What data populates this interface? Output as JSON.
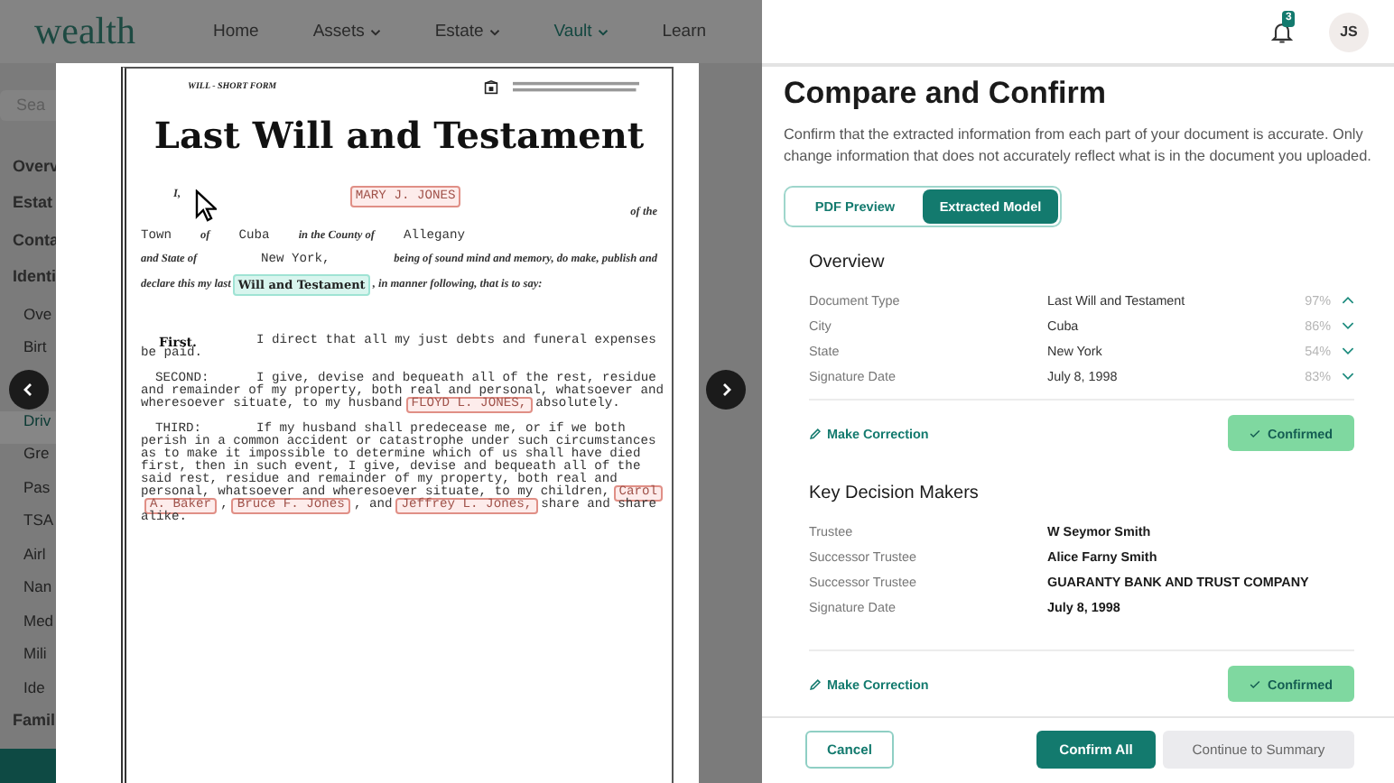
{
  "app_nav": {
    "logo": "wealth",
    "items": [
      {
        "label": "Home",
        "dropdown": false,
        "selected": false
      },
      {
        "label": "Assets",
        "dropdown": true,
        "selected": false
      },
      {
        "label": "Estate",
        "dropdown": true,
        "selected": false
      },
      {
        "label": "Vault",
        "dropdown": true,
        "selected": true
      },
      {
        "label": "Learn",
        "dropdown": false,
        "selected": false
      }
    ]
  },
  "sidebar": {
    "search": {
      "placeholder": "Sea"
    },
    "items": [
      {
        "label": "Overv",
        "kind": "section",
        "selected": false
      },
      {
        "label": "Estat",
        "kind": "section",
        "selected": false
      },
      {
        "label": "Conta",
        "kind": "section",
        "selected": false
      },
      {
        "label": "Identi",
        "kind": "section",
        "selected": false
      },
      {
        "label": "Ove",
        "kind": "subitem",
        "selected": false
      },
      {
        "label": "Birt",
        "kind": "subitem",
        "selected": false
      },
      {
        "label": "Driv",
        "kind": "subitem",
        "selected": true
      },
      {
        "label": "Gre",
        "kind": "subitem",
        "selected": false
      },
      {
        "label": "Pas",
        "kind": "subitem",
        "selected": false
      },
      {
        "label": "TSA",
        "kind": "subitem",
        "selected": false
      },
      {
        "label": "Airl",
        "kind": "subitem",
        "selected": false
      },
      {
        "label": "Nan",
        "kind": "subitem",
        "selected": false
      },
      {
        "label": "Med",
        "kind": "subitem",
        "selected": false
      },
      {
        "label": "Mili",
        "kind": "subitem",
        "selected": false
      },
      {
        "label": "Ide",
        "kind": "subitem",
        "selected": false
      },
      {
        "label": "Famil",
        "kind": "section",
        "selected": false
      }
    ]
  },
  "document": {
    "form_label": "WILL - SHORT FORM",
    "title": "Last Will and Testament",
    "form_lines": [
      [
        {
          "kind": "form",
          "text": "I,"
        },
        {
          "kind": "entity",
          "text": "MARY J. JONES"
        },
        {
          "kind": "form",
          "text": "of the"
        }
      ],
      [
        {
          "kind": "typed",
          "text": "Town"
        },
        {
          "kind": "form",
          "text": "of"
        },
        {
          "kind": "typed",
          "text": "Cuba"
        },
        {
          "kind": "form",
          "text": "in the County of"
        },
        {
          "kind": "typed",
          "text": "Allegany"
        }
      ],
      [
        {
          "kind": "form",
          "text": "and State of"
        },
        {
          "kind": "typed",
          "text": "New York,"
        },
        {
          "kind": "form",
          "text": "being of sound mind and memory, do make, publish and"
        }
      ],
      [
        {
          "kind": "form",
          "text": "declare this my last"
        },
        {
          "kind": "doctype",
          "text": "Will and Testament"
        },
        {
          "kind": "form",
          "text": ", in manner following, that is to say:"
        }
      ]
    ],
    "paragraphs": [
      {
        "label": "First.",
        "kind": "blackletter",
        "lines": [
          [
            {
              "kind": "typed",
              "text": "I direct that all my just debts and funeral expenses"
            }
          ],
          [
            {
              "kind": "typed",
              "text": "be paid."
            }
          ]
        ]
      },
      {
        "label": "SECOND:",
        "kind": "typed",
        "lines": [
          [
            {
              "kind": "typed",
              "text": "I give, devise and bequeath all of the rest, residue"
            }
          ],
          [
            {
              "kind": "typed",
              "text": "and remainder of my property, both real and personal, whatsoever and"
            }
          ],
          [
            {
              "kind": "typed",
              "text": "wheresoever situate, to my husband"
            },
            {
              "kind": "entity",
              "text": "FLOYD L. JONES,"
            },
            {
              "kind": "typed",
              "text": "absolutely."
            }
          ]
        ]
      },
      {
        "label": "THIRD:",
        "kind": "typed",
        "lines": [
          [
            {
              "kind": "typed",
              "text": "If my husband shall predecease me, or if we both"
            }
          ],
          [
            {
              "kind": "typed",
              "text": "perish in a common accident or catastrophe under such circumstances"
            }
          ],
          [
            {
              "kind": "typed",
              "text": "as to make it impossible to determine which of us shall have died"
            }
          ],
          [
            {
              "kind": "typed",
              "text": "first, then in such event, I give, devise and bequeath all of the"
            }
          ],
          [
            {
              "kind": "typed",
              "text": "said rest, residue and remainder of my property, both real and"
            }
          ],
          [
            {
              "kind": "typed",
              "text": "personal, whatsoever and wheresoever situate, to my children,"
            },
            {
              "kind": "entity",
              "text": "Carol"
            }
          ],
          [
            {
              "kind": "entity",
              "text": "A. Baker"
            },
            {
              "kind": "typed",
              "text": ","
            },
            {
              "kind": "entity",
              "text": "Bruce F. Jones"
            },
            {
              "kind": "typed",
              "text": ", and"
            },
            {
              "kind": "entity",
              "text": "Jeffrey L. Jones,"
            },
            {
              "kind": "typed",
              "text": "share and share"
            }
          ],
          [
            {
              "kind": "typed",
              "text": "alike."
            }
          ]
        ]
      }
    ]
  },
  "header": {
    "notification_count": "3",
    "avatar": "JS"
  },
  "panel": {
    "title": "Compare and Confirm",
    "description": "Confirm that the extracted information from each part of your document is accurate. Only change information that does not accurately reflect what is in the document you uploaded.",
    "view_tabs": [
      {
        "label": "PDF Preview",
        "selected": false
      },
      {
        "label": "Extracted Model",
        "selected": true
      }
    ],
    "sections": [
      {
        "title": "Overview",
        "rows": [
          {
            "label": "Document Type",
            "value": "Last Will and Testament",
            "confidence": "97%",
            "expanded": true
          },
          {
            "label": "City",
            "value": "Cuba",
            "confidence": "86%",
            "expanded": false
          },
          {
            "label": "State",
            "value": "New York",
            "confidence": "54%",
            "expanded": false
          },
          {
            "label": "Signature Date",
            "value": "July 8, 1998",
            "confidence": "83%",
            "expanded": false
          }
        ],
        "correction_link": "Make Correction",
        "status": {
          "label": "Confirmed",
          "confirmed": true
        }
      },
      {
        "title": "Key Decision Makers",
        "rows": [
          {
            "label": "Trustee",
            "value": "W Seymor Smith"
          },
          {
            "label": "Successor Trustee",
            "value": "Alice Farny Smith"
          },
          {
            "label": "Successor Trustee",
            "value": "GUARANTY BANK AND TRUST COMPANY"
          },
          {
            "label": "Signature Date",
            "value": "July 8, 1998"
          }
        ],
        "correction_link": "Make Correction",
        "status": {
          "label": "Confirmed",
          "confirmed": true
        }
      }
    ]
  },
  "footer": {
    "buttons": [
      {
        "label": "Cancel",
        "kind": "secondary",
        "disabled": false
      },
      {
        "label": "Confirm All",
        "kind": "primary",
        "disabled": false
      },
      {
        "label": "Continue to Summary",
        "kind": "primary",
        "disabled": true
      }
    ]
  }
}
